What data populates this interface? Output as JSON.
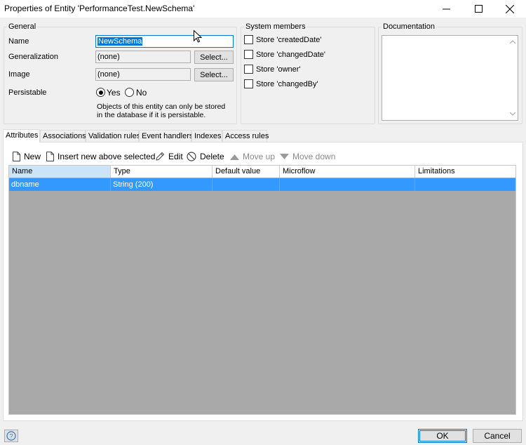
{
  "window": {
    "title": "Properties of Entity 'PerformanceTest.NewSchema'"
  },
  "general": {
    "legend": "General",
    "name_label": "Name",
    "name_value": "NewSchema",
    "generalization_label": "Generalization",
    "generalization_value": "(none)",
    "generalization_button": "Select...",
    "image_label": "Image",
    "image_value": "(none)",
    "image_button": "Select...",
    "persistable_label": "Persistable",
    "persistable_yes": "Yes",
    "persistable_no": "No",
    "persistable_selected": "Yes",
    "note_line1": "Objects of this entity can only be stored",
    "note_line2": "in the database if it is persistable."
  },
  "system_members": {
    "legend": "System members",
    "items": [
      {
        "label": "Store 'createdDate'",
        "checked": false
      },
      {
        "label": "Store 'changedDate'",
        "checked": false
      },
      {
        "label": "Store 'owner'",
        "checked": false
      },
      {
        "label": "Store 'changedBy'",
        "checked": false
      }
    ]
  },
  "documentation": {
    "legend": "Documentation",
    "value": ""
  },
  "tabs": [
    {
      "label": "Attributes",
      "active": true
    },
    {
      "label": "Associations",
      "active": false
    },
    {
      "label": "Validation rules",
      "active": false
    },
    {
      "label": "Event handlers",
      "active": false
    },
    {
      "label": "Indexes",
      "active": false
    },
    {
      "label": "Access rules",
      "active": false
    }
  ],
  "toolbar": {
    "new": "New",
    "insert": "Insert new above selected",
    "edit": "Edit",
    "delete": "Delete",
    "move_up": "Move up",
    "move_down": "Move down"
  },
  "grid": {
    "columns": [
      "Name",
      "Type",
      "Default value",
      "Microflow",
      "Limitations"
    ],
    "rows": [
      {
        "name": "dbname",
        "type": "String (200)",
        "default_value": "",
        "microflow": "",
        "limitations": ""
      }
    ]
  },
  "footer": {
    "help": "?",
    "ok": "OK",
    "cancel": "Cancel"
  },
  "colors": {
    "selection": "#3399ff",
    "accent": "#0078d7"
  }
}
